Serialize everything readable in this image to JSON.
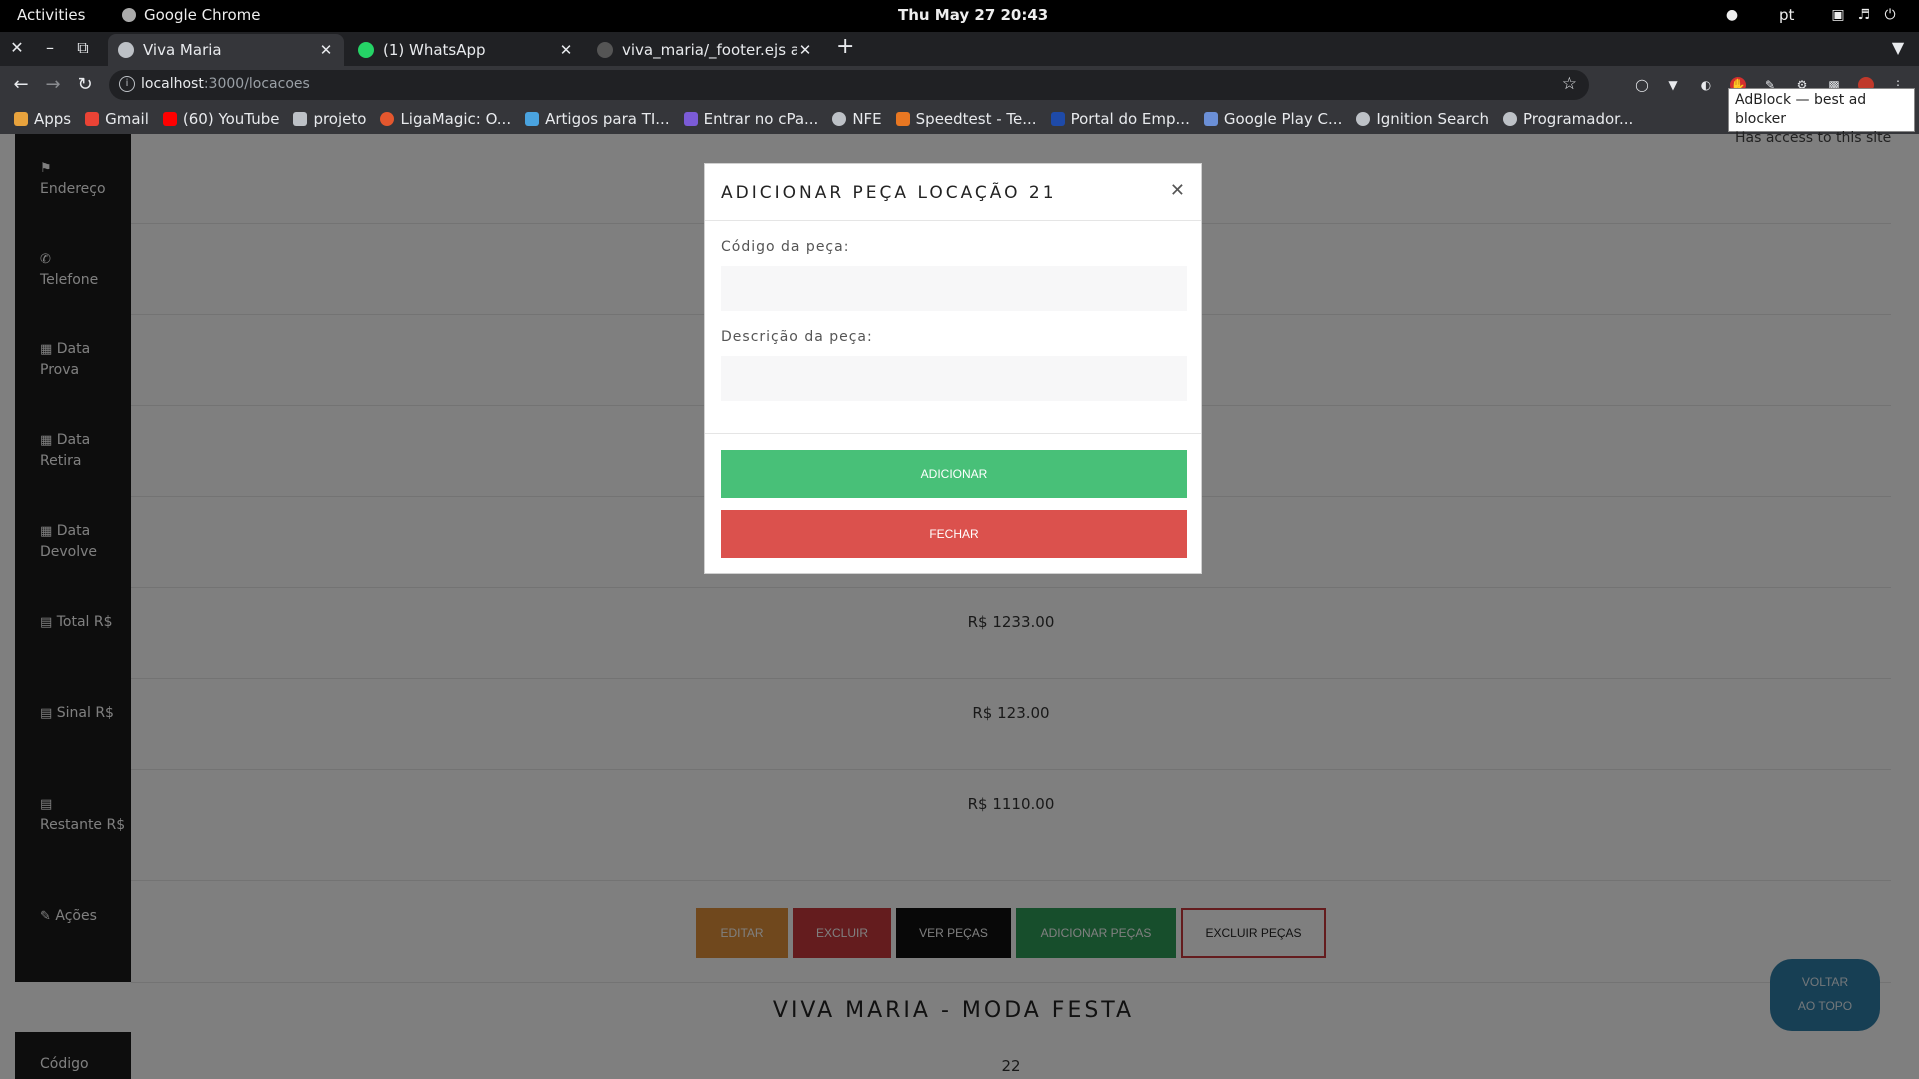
{
  "topbar": {
    "activities": "Activities",
    "app_name": "Google Chrome",
    "clock": "Thu May 27  20:43",
    "lang": "pt"
  },
  "tabs": [
    {
      "label": "Viva Maria",
      "active": true
    },
    {
      "label": "(1) WhatsApp",
      "active": false
    },
    {
      "label": "viva_maria/_footer.ejs at c",
      "active": false
    }
  ],
  "omnibox": {
    "host": "localhost",
    "path": ":3000/locacoes"
  },
  "bookmarks": [
    {
      "label": "Apps",
      "icon": "apps-grid-icon",
      "color": "#e8a33d"
    },
    {
      "label": "Gmail",
      "icon": "gmail-icon",
      "color": "#ea4335"
    },
    {
      "label": "(60) YouTube",
      "icon": "youtube-icon",
      "color": "#ff0000"
    },
    {
      "label": "projeto",
      "icon": "folder-icon",
      "color": "#bdc1c6"
    },
    {
      "label": "LigaMagic: O...",
      "icon": "ligamagic-icon",
      "color": "#e4572e"
    },
    {
      "label": "Artigos para TI...",
      "icon": "artigos-icon",
      "color": "#4aa3df"
    },
    {
      "label": "Entrar no cPa...",
      "icon": "cpanel-icon",
      "color": "#7b5bd6"
    },
    {
      "label": "NFE",
      "icon": "globe-icon",
      "color": "#bdc1c6"
    },
    {
      "label": "Speedtest - Te...",
      "icon": "speedtest-icon",
      "color": "#e87722"
    },
    {
      "label": "Portal do Emp...",
      "icon": "portal-icon",
      "color": "#1e4aa8"
    },
    {
      "label": "Google Play C...",
      "icon": "google-play-icon",
      "color": "#6b8fd6"
    },
    {
      "label": "Ignition Search",
      "icon": "globe-icon",
      "color": "#bdc1c6"
    },
    {
      "label": "Programador...",
      "icon": "globe-icon",
      "color": "#bdc1c6"
    }
  ],
  "tooltip": {
    "line1": "AdBlock — best ad blocker",
    "line2": "Has access to this site"
  },
  "sidebar": [
    {
      "label": "Endereço",
      "icon": "map-icon"
    },
    {
      "label": "Telefone",
      "icon": "phone-icon"
    },
    {
      "label": "Data Prova",
      "icon": "calendar-icon"
    },
    {
      "label": "Data Retira",
      "icon": "calendar-icon"
    },
    {
      "label": "Data Devolve",
      "icon": "calendar-icon"
    },
    {
      "label": "Total R$",
      "icon": "money-icon"
    },
    {
      "label": "Sinal R$",
      "icon": "money-icon"
    },
    {
      "label": "Restante R$",
      "icon": "money-icon"
    },
    {
      "label": "Ações",
      "icon": "edit-icon"
    }
  ],
  "values": {
    "total": "R$ 1233.00",
    "sinal": "R$ 123.00",
    "restante": "R$ 1110.00"
  },
  "actions": {
    "editar": "EDITAR",
    "excluir": "EXCLUIR",
    "ver_pecas": "VER PEÇAS",
    "adicionar_pecas": "ADICIONAR PEÇAS",
    "excluir_pecas": "EXCLUIR PEÇAS"
  },
  "next_record": {
    "title": "VIVA MARIA - MODA FESTA",
    "codigo_label": "Código",
    "codigo_value": "22"
  },
  "back_to_top": {
    "line1": "VOLTAR",
    "line2": "AO TOPO"
  },
  "modal": {
    "title": "ADICIONAR PEÇA LOCAÇÃO 21",
    "codigo_label": "Código da peça:",
    "codigo_value": "",
    "descricao_label": "Descrição da peça:",
    "descricao_value": "",
    "add_button": "ADICIONAR",
    "close_button": "FECHAR"
  },
  "colors": {
    "editar": "#e0913a",
    "excluir": "#c9393d",
    "ver_pecas": "#111111",
    "adicionar_pecas": "#2e9c58",
    "excluir_pecas_border": "#c9393d",
    "modal_add": "#48c078",
    "modal_close": "#db514d"
  }
}
